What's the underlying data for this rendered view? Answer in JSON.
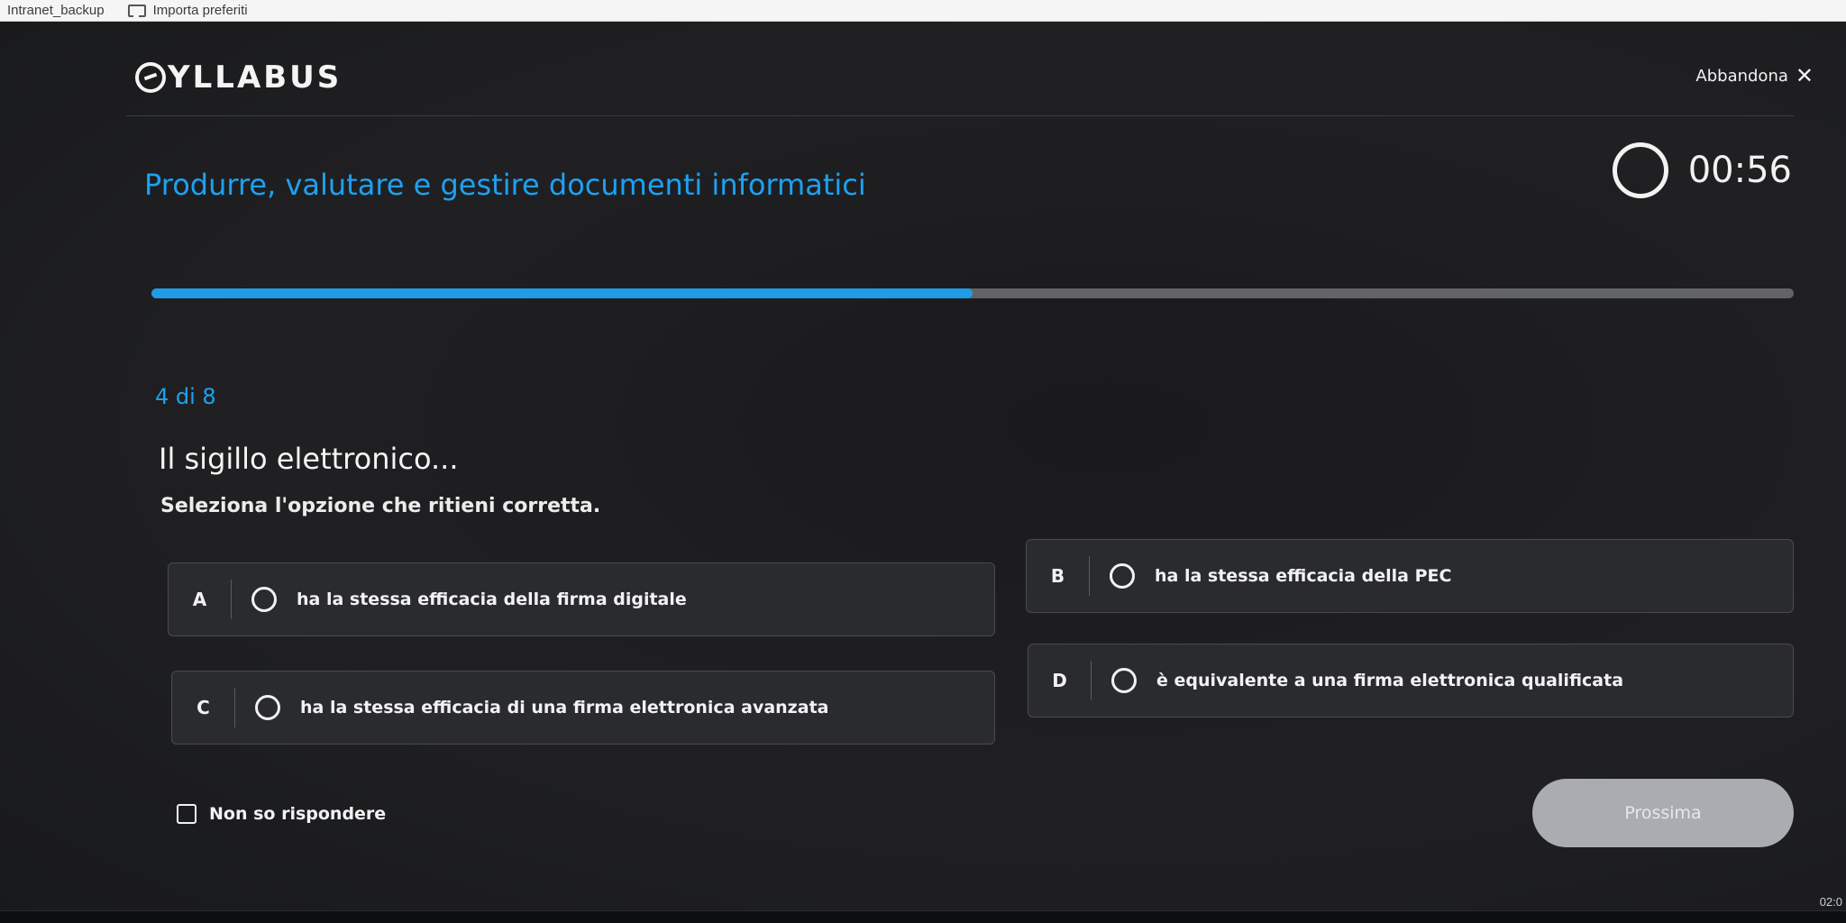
{
  "browser": {
    "bookmarks": [
      {
        "label": "Intranet_backup"
      },
      {
        "label": "Importa preferiti"
      }
    ]
  },
  "header": {
    "logo_text": "YLLABUS",
    "abandon_label": "Abbandona",
    "close_symbol": "✕"
  },
  "quiz": {
    "course_title": "Produrre, valutare e gestire documenti informatici",
    "timer": "00:56",
    "progress_fraction": 0.5,
    "step_label": "4 di 8",
    "question": "Il sigillo elettronico...",
    "instruction": "Seleziona l'opzione che ritieni corretta.",
    "options": [
      {
        "letter": "A",
        "text": "ha la stessa efficacia della firma digitale"
      },
      {
        "letter": "B",
        "text": "ha la stessa efficacia della PEC"
      },
      {
        "letter": "C",
        "text": "ha la stessa efficacia di una firma elettronica avanzata"
      },
      {
        "letter": "D",
        "text": "è equivalente a una firma elettronica qualificata"
      }
    ],
    "dont_know_label": "Non so rispondere",
    "next_label": "Prossima"
  },
  "system": {
    "clock": "02:0"
  },
  "colors": {
    "accent": "#1da1f2",
    "progress_fill": "#1e9ce6",
    "progress_track": "#626366",
    "button_disabled": "#a9acb0"
  }
}
